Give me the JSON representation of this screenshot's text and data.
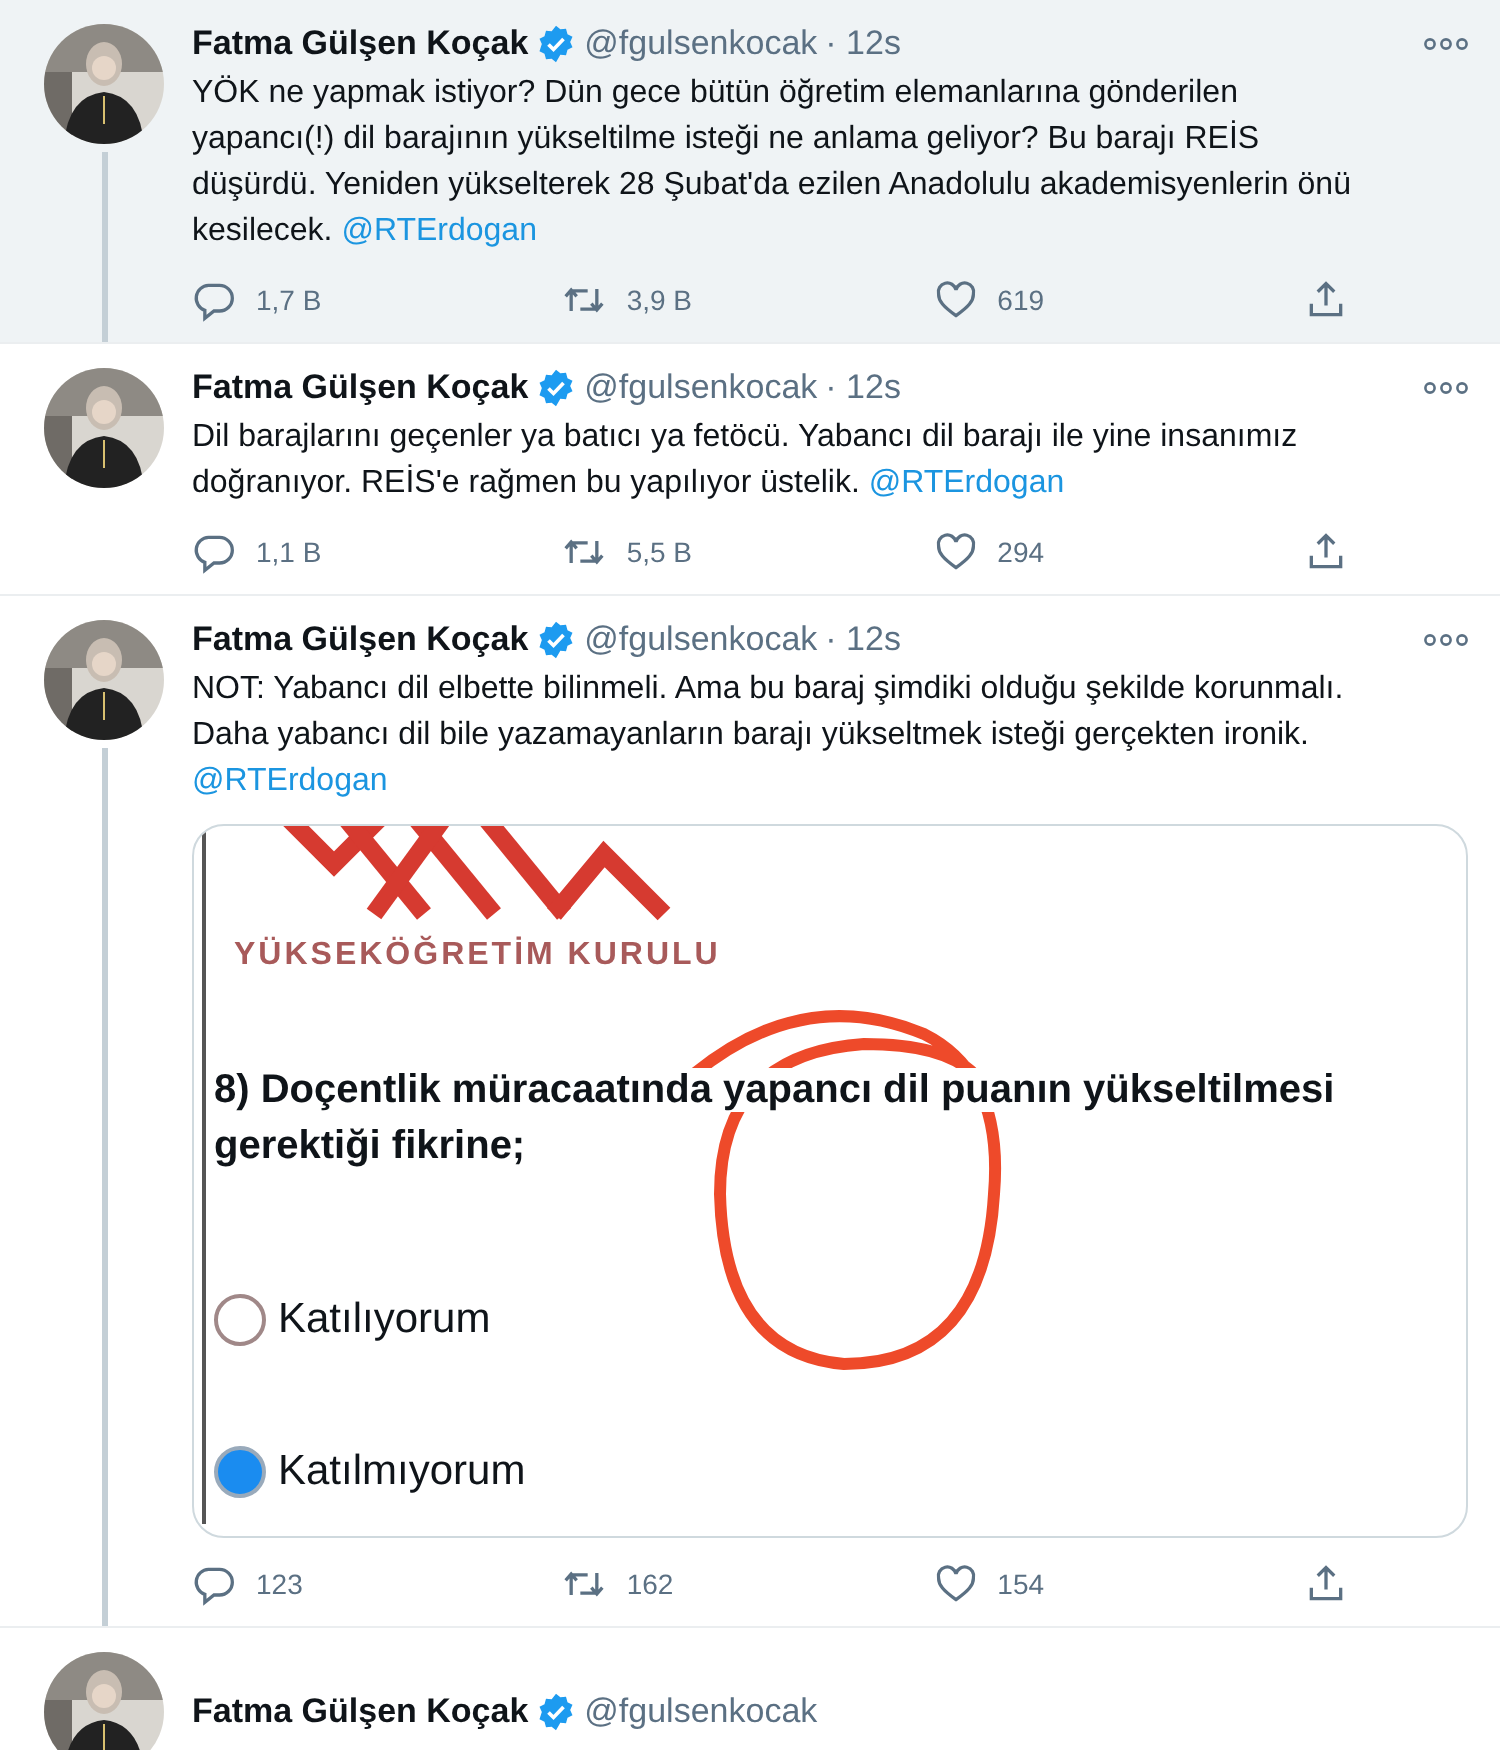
{
  "tweets": [
    {
      "author": "Fatma Gülşen Koçak",
      "verified": true,
      "handle": "@fgulsenkocak",
      "time": "· 12s",
      "highlighted": true,
      "thread_line": true,
      "text": "YÖK ne yapmak istiyor? Dün gece bütün öğretim elemanlarına gönderilen yapancı(!) dil barajının yükseltilme isteği ne anlama geliyor? Bu barajı REİS düşürdü. Yeniden yükselterek 28 Şubat'da ezilen Anadolulu akademisyenlerin önü kesilecek.",
      "mention": "@RTErdogan",
      "replies": "1,7 B",
      "retweets": "3,9 B",
      "likes": "619"
    },
    {
      "author": "Fatma Gülşen Koçak",
      "verified": true,
      "handle": "@fgulsenkocak",
      "time": "· 12s",
      "highlighted": false,
      "thread_line": false,
      "text": "Dil barajlarını geçenler ya batıcı ya fetöcü. Yabancı dil barajı ile yine insanımız doğranıyor. REİS'e rağmen bu yapılıyor üstelik.",
      "mention": "@RTErdogan",
      "replies": "1,1 B",
      "retweets": "5,5 B",
      "likes": "294"
    },
    {
      "author": "Fatma Gülşen Koçak",
      "verified": true,
      "handle": "@fgulsenkocak",
      "time": "· 12s",
      "highlighted": false,
      "thread_line": true,
      "text": "NOT: Yabancı dil elbette bilinmeli. Ama bu baraj şimdiki olduğu şekilde korunmalı. Daha yabancı dil bile yazamayanların barajı yükseltmek isteği gerçekten ironik.",
      "mention": "@RTErdogan",
      "replies": "123",
      "retweets": "162",
      "likes": "154",
      "media": {
        "kind": "document",
        "org": "YÜKSEKÖĞRETİM KURULU",
        "question": [
          "8) Doçentlik müracaatında yapancı dil puanın yükseltilmesi",
          "gerektiği fikrine;"
        ],
        "options": [
          {
            "label": "Katılıyorum",
            "selected": false
          },
          {
            "label": "Katılmıyorum",
            "selected": true
          }
        ]
      }
    }
  ],
  "next_tweet": {
    "author": "Fatma Gülşen Koçak",
    "verified": true,
    "handle": "@fgulsenkocak"
  }
}
